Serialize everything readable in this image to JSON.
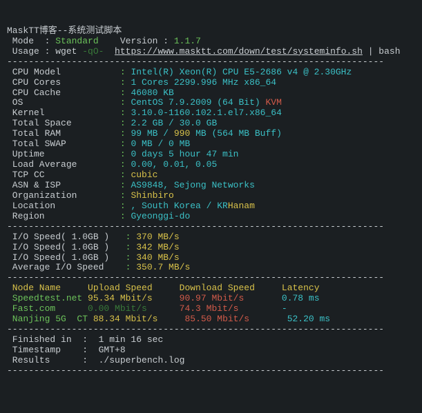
{
  "header": {
    "title": "MaskTT博客--系统测试脚本",
    "mode_label": " Mode  : ",
    "mode_value": "Standard",
    "version_label": "    Version : ",
    "version_value": "1.1.7",
    "usage_prefix": " Usage : wget ",
    "usage_flag": "-qO-",
    "usage_sep": "  ",
    "usage_url": "https://www.masktt.com/down/test/systeminfo.sh",
    "usage_suffix": " | bash"
  },
  "sys": {
    "rows": [
      {
        "label": " CPU Model          ",
        "sep": " : ",
        "plain_pre": "",
        "cyan": "Intel(R) Xeon(R) CPU E5-2686 v4 @ 2.30GHz"
      },
      {
        "label": " CPU Cores          ",
        "sep": " : ",
        "plain_pre": "",
        "cyan": "1 Cores 2299.996 MHz x86_64"
      },
      {
        "label": " CPU Cache          ",
        "sep": " : ",
        "plain_pre": "",
        "cyan": "46080 KB"
      },
      {
        "label": " OS                 ",
        "sep": " : ",
        "plain_pre": "",
        "cyan": "CentOS 7.9.2009 (64 Bit) ",
        "red": "KVM"
      },
      {
        "label": " Kernel             ",
        "sep": " : ",
        "plain_pre": "",
        "cyan": "3.10.0-1160.102.1.el7.x86_64"
      },
      {
        "label": " Total Space        ",
        "sep": " : ",
        "plain_pre": "",
        "cyan": "2.2 GB / 30.0 GB"
      },
      {
        "label": " Total RAM          ",
        "sep": " : ",
        "plain_pre": "",
        "cyan": "99 MB / ",
        "yellow": "990",
        "cyan2": " MB (564 MB Buff)"
      },
      {
        "label": " Total SWAP         ",
        "sep": " : ",
        "plain_pre": "",
        "cyan": "0 MB / 0 MB"
      },
      {
        "label": " Uptime             ",
        "sep": " : ",
        "plain_pre": "",
        "cyan": "0 days 5 hour 47 min"
      },
      {
        "label": " Load Average       ",
        "sep": " : ",
        "plain_pre": "",
        "cyan": "0.00, 0.01, 0.05"
      },
      {
        "label": " TCP CC             ",
        "sep": " : ",
        "plain_pre": "",
        "yellow": "cubic"
      },
      {
        "label": " ASN & ISP          ",
        "sep": " : ",
        "plain_pre": "",
        "cyan": "AS9848, Sejong Networks"
      },
      {
        "label": " Organization       ",
        "sep": " : ",
        "plain_pre": "",
        "yellow": "Shinbiro"
      },
      {
        "label": " Location           ",
        "sep": " : ",
        "plain_pre": "",
        "yellow": "Hanam",
        "cyan": ", South Korea / KR"
      },
      {
        "label": " Region             ",
        "sep": " : ",
        "plain_pre": "",
        "cyan": "Gyeonggi-do"
      }
    ]
  },
  "io": {
    "rows": [
      {
        "label": " I/O Speed( 1.0GB ) ",
        "sep": "  : ",
        "yellow": "370 MB/s"
      },
      {
        "label": " I/O Speed( 1.0GB ) ",
        "sep": "  : ",
        "yellow": "342 MB/s"
      },
      {
        "label": " I/O Speed( 1.0GB ) ",
        "sep": "  : ",
        "yellow": "340 MB/s"
      },
      {
        "label": " Average I/O Speed  ",
        "sep": "  : ",
        "yellow": "350.7 MB/s"
      }
    ]
  },
  "speed": {
    "header": {
      "node": " Node Name     ",
      "up": "Upload Speed     ",
      "down": "Download Speed     ",
      "lat": "Latency   "
    },
    "rows": [
      {
        "node": " Speedtest.net ",
        "up": "95.34 Mbit/s     ",
        "down": "90.97 Mbit/s       ",
        "lat": "0.78 ms   ",
        "dg": false
      },
      {
        "node": " Fast.com      ",
        "up": "0.00 Mbit/s      ",
        "down": "74.3 Mbit/s        ",
        "lat": "-         ",
        "dg": true
      },
      {
        "node": " Nanjing 5G  CT",
        "pad": " ",
        "up": "88.34 Mbit/s     ",
        "down": "85.50 Mbit/s       ",
        "lat": "52.20 ms  ",
        "dg": false
      }
    ]
  },
  "footer": {
    "finished_label": " Finished in  :  ",
    "finished_value": "1 min 16 sec",
    "ts_label": " Timestamp    :  ",
    "ts_value": "GMT+8",
    "res_label": " Results      :  ",
    "res_value": "./superbench.log"
  },
  "dash": "----------------------------------------------------------------------"
}
